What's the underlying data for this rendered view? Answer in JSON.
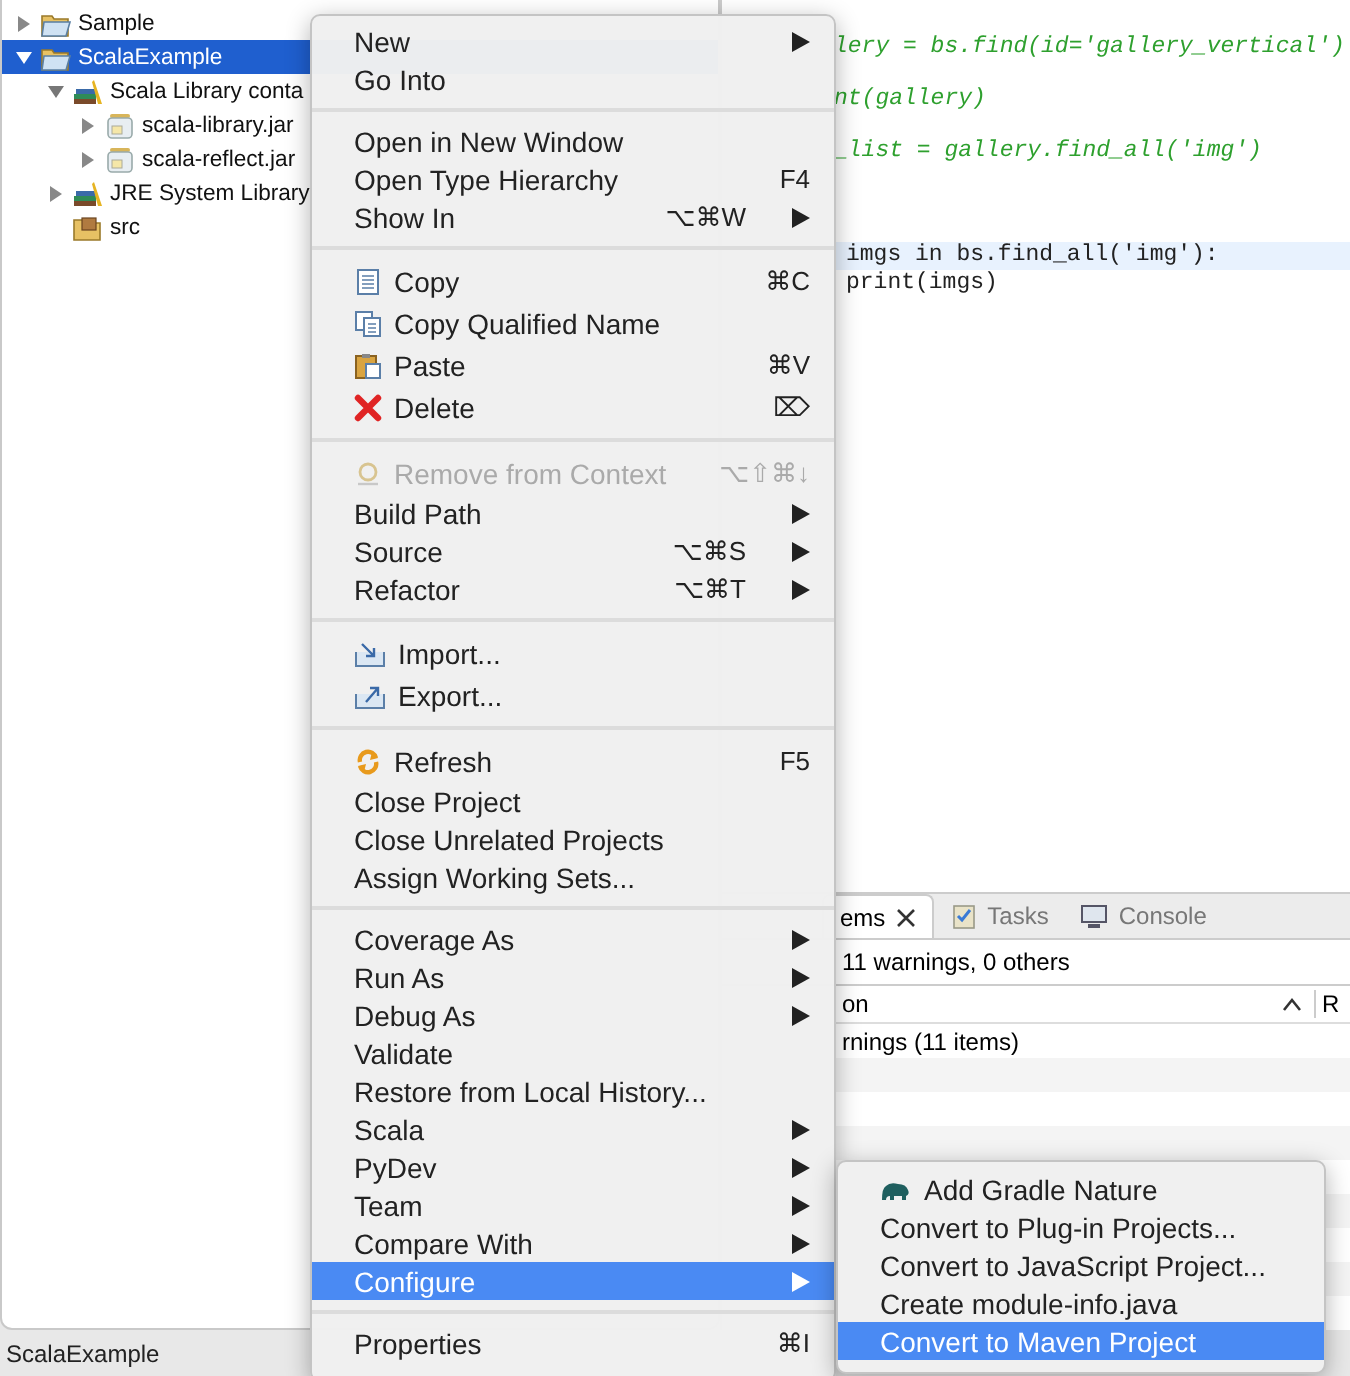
{
  "tree": [
    {
      "label": "Sample",
      "kind": "project",
      "expanded": false,
      "selected": false
    },
    {
      "label": "ScalaExample",
      "kind": "project",
      "expanded": true,
      "selected": true,
      "children": [
        {
          "label": "Scala Library conta",
          "kind": "library",
          "expanded": true,
          "selected": false,
          "children": [
            {
              "label": "scala-library.jar",
              "kind": "jar",
              "expanded": false,
              "selected": false
            },
            {
              "label": "scala-reflect.jar",
              "kind": "jar",
              "expanded": false,
              "selected": false
            }
          ]
        },
        {
          "label": "JRE System Library",
          "kind": "library",
          "expanded": false,
          "selected": false
        },
        {
          "label": "src",
          "kind": "source",
          "selected": false
        }
      ]
    }
  ],
  "editor": {
    "lines": [
      {
        "text": "lery = bs.find(id='gallery_vertical')",
        "kind": "comment",
        "highlighted": false
      },
      {
        "text": "nt(gallery)",
        "kind": "comment",
        "highlighted": false
      },
      {
        "text": "_list = gallery.find_all('img')",
        "kind": "comment",
        "highlighted": false
      },
      {
        "text": "imgs in bs.find_all('img'):",
        "kind": "code",
        "highlighted": true
      },
      {
        "text": "print(imgs)",
        "kind": "code",
        "highlighted": false
      }
    ]
  },
  "problems_view": {
    "tabs": [
      {
        "label": "ems",
        "selected": true,
        "closable": true,
        "kind": "problems"
      },
      {
        "label": "Tasks",
        "selected": false,
        "closable": false,
        "kind": "tasks"
      },
      {
        "label": "Console",
        "selected": false,
        "closable": false,
        "kind": "console"
      }
    ],
    "summary": "11 warnings, 0 others",
    "columns": [
      "on",
      "R"
    ],
    "rows": [
      "rnings (11 items)"
    ]
  },
  "status_bar": "ScalaExample",
  "context_menu": {
    "sections": [
      [
        {
          "label": "New",
          "kind": "plain",
          "submenu": true,
          "disabled": false,
          "selected": false
        },
        {
          "label": "Go Into",
          "kind": "plain",
          "submenu": false,
          "disabled": false,
          "selected": false
        }
      ],
      [
        {
          "label": "Open in New Window",
          "kind": "plain",
          "submenu": false,
          "disabled": false,
          "selected": false
        },
        {
          "label": "Open Type Hierarchy",
          "kind": "plain",
          "shortcut": "F4",
          "submenu": false,
          "disabled": false,
          "selected": false
        },
        {
          "label": "Show In",
          "kind": "plain",
          "shortcut": "⌥⌘W",
          "submenu": true,
          "disabled": false,
          "selected": false
        }
      ],
      [
        {
          "label": "Copy",
          "kind": "copy",
          "shortcut": "⌘C",
          "submenu": false,
          "disabled": false,
          "selected": false
        },
        {
          "label": "Copy Qualified Name",
          "kind": "copy-name",
          "submenu": false,
          "disabled": false,
          "selected": false
        },
        {
          "label": "Paste",
          "kind": "paste",
          "shortcut": "⌘V",
          "submenu": false,
          "disabled": false,
          "selected": false
        },
        {
          "label": "Delete",
          "kind": "delete",
          "shortcut": "⌦",
          "submenu": false,
          "disabled": false,
          "selected": false
        }
      ],
      [
        {
          "label": "Remove from Context",
          "kind": "remove",
          "shortcut": "⌥⇧⌘↓",
          "submenu": false,
          "disabled": true,
          "selected": false
        },
        {
          "label": "Build Path",
          "kind": "plain",
          "submenu": true,
          "disabled": false,
          "selected": false
        },
        {
          "label": "Source",
          "kind": "plain",
          "shortcut": "⌥⌘S",
          "submenu": true,
          "disabled": false,
          "selected": false
        },
        {
          "label": "Refactor",
          "kind": "plain",
          "shortcut": "⌥⌘T",
          "submenu": true,
          "disabled": false,
          "selected": false
        }
      ],
      [
        {
          "label": "Import...",
          "kind": "import",
          "submenu": false,
          "disabled": false,
          "selected": false
        },
        {
          "label": "Export...",
          "kind": "export",
          "submenu": false,
          "disabled": false,
          "selected": false
        }
      ],
      [
        {
          "label": "Refresh",
          "kind": "refresh",
          "shortcut": "F5",
          "submenu": false,
          "disabled": false,
          "selected": false
        },
        {
          "label": "Close Project",
          "kind": "plain",
          "submenu": false,
          "disabled": false,
          "selected": false
        },
        {
          "label": "Close Unrelated Projects",
          "kind": "plain",
          "submenu": false,
          "disabled": false,
          "selected": false
        },
        {
          "label": "Assign Working Sets...",
          "kind": "plain",
          "submenu": false,
          "disabled": false,
          "selected": false
        }
      ],
      [
        {
          "label": "Coverage As",
          "kind": "plain",
          "submenu": true,
          "disabled": false,
          "selected": false
        },
        {
          "label": "Run As",
          "kind": "plain",
          "submenu": true,
          "disabled": false,
          "selected": false
        },
        {
          "label": "Debug As",
          "kind": "plain",
          "submenu": true,
          "disabled": false,
          "selected": false
        },
        {
          "label": "Validate",
          "kind": "plain",
          "submenu": false,
          "disabled": false,
          "selected": false
        },
        {
          "label": "Restore from Local History...",
          "kind": "plain",
          "submenu": false,
          "disabled": false,
          "selected": false
        },
        {
          "label": "Scala",
          "kind": "plain",
          "submenu": true,
          "disabled": false,
          "selected": false
        },
        {
          "label": "PyDev",
          "kind": "plain",
          "submenu": true,
          "disabled": false,
          "selected": false
        },
        {
          "label": "Team",
          "kind": "plain",
          "submenu": true,
          "disabled": false,
          "selected": false
        },
        {
          "label": "Compare With",
          "kind": "plain",
          "submenu": true,
          "disabled": false,
          "selected": false
        },
        {
          "label": "Configure",
          "kind": "plain",
          "submenu": true,
          "disabled": false,
          "selected": true
        }
      ],
      [
        {
          "label": "Properties",
          "kind": "plain",
          "shortcut": "⌘I",
          "submenu": false,
          "disabled": false,
          "selected": false
        }
      ]
    ]
  },
  "submenu": {
    "items": [
      {
        "label": "Add Gradle Nature",
        "kind": "gradle",
        "selected": false
      },
      {
        "label": "Convert to Plug-in Projects...",
        "kind": "plain",
        "selected": false
      },
      {
        "label": "Convert to JavaScript Project...",
        "kind": "plain",
        "selected": false
      },
      {
        "label": "Create module-info.java",
        "kind": "plain",
        "selected": false
      },
      {
        "label": "Convert to Maven Project",
        "kind": "plain",
        "selected": true
      }
    ]
  }
}
